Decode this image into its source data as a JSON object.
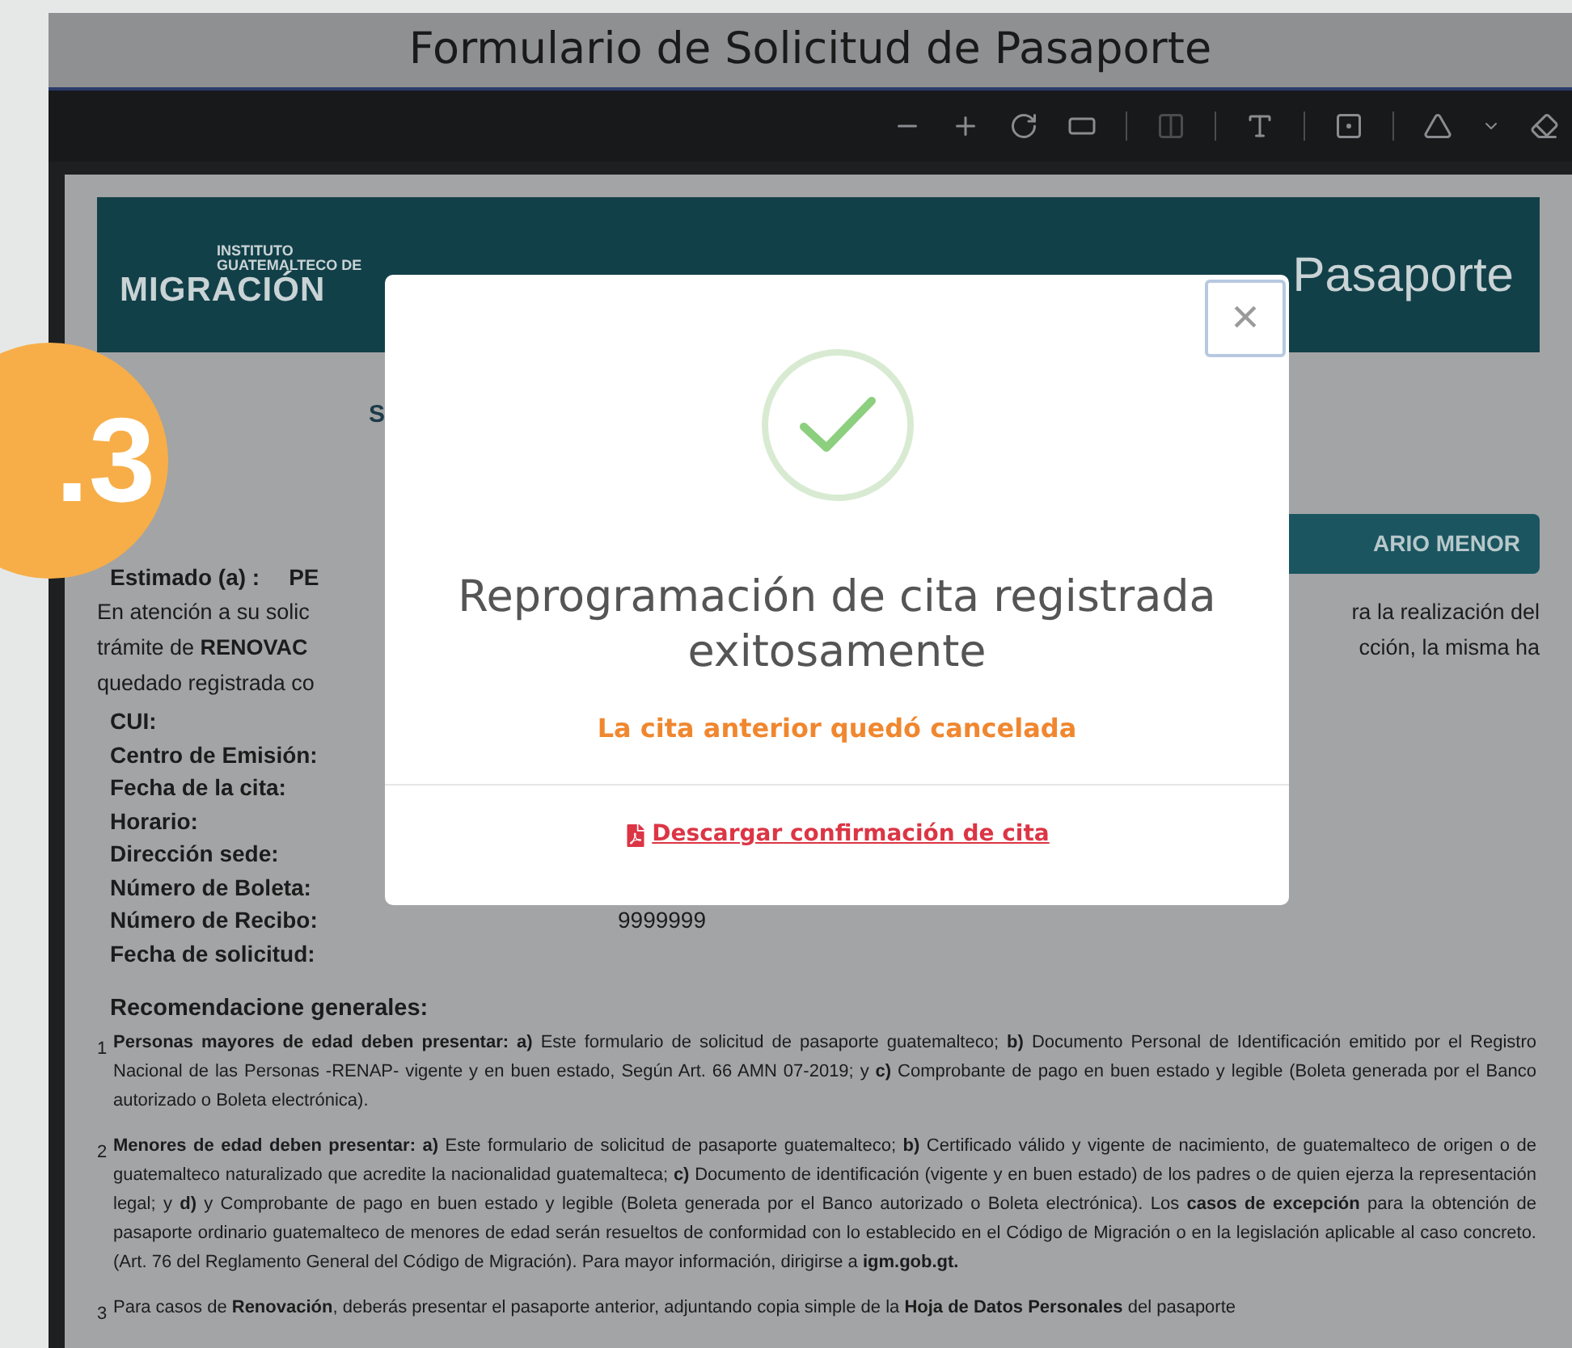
{
  "viewer": {
    "title": "Formulario de Solicitud de Pasaporte"
  },
  "badge": {
    "label": ".3"
  },
  "document": {
    "banner": {
      "org_line1": "INSTITUTO",
      "org_line2": "GUATEMALTECO DE",
      "org_name": "MIGRACIÓN",
      "title_visible": "Pasaporte"
    },
    "heading_fragment": "S",
    "button_fragment": "ARIO MENOR",
    "greeting": {
      "label": "Estimado (a) :",
      "value_fragment": "PE"
    },
    "intro_lines": [
      {
        "left": "En atención a su solic",
        "right": "ra la realización del"
      },
      {
        "left": "trámite de **RENOVAC**",
        "right": "cción, la misma ha"
      },
      {
        "left": "quedado registrada co"
      }
    ],
    "fields": [
      {
        "label": "CUI:"
      },
      {
        "label": "Centro de Emisión:"
      },
      {
        "label": "Fecha de la cita:"
      },
      {
        "label": "Horario:"
      },
      {
        "label": "Dirección sede:"
      },
      {
        "label": "Número de Boleta:"
      },
      {
        "label": "Número de Recibo:",
        "value": "9999999"
      },
      {
        "label": "Fecha de solicitud:"
      }
    ],
    "recommendations_title": "Recomendacione generales:",
    "recommendations": [
      {
        "number": "1",
        "text": "**Personas mayores de edad deben presentar: a)** Este formulario de solicitud de pasaporte guatemalteco; **b)** Documento Personal de Identificación emitido por el Registro Nacional de las Personas -RENAP- vigente y en buen estado, Según Art. 66 AMN 07-2019; y **c)** Comprobante de pago en buen estado y legible (Boleta generada por el Banco autorizado o Boleta electrónica)."
      },
      {
        "number": "2",
        "text": "**Menores de edad deben presentar: a)** Este formulario de solicitud de pasaporte guatemalteco; **b)** Certificado válido y vigente de nacimiento, de guatemalteco de origen o de guatemalteco naturalizado que acredite la nacionalidad guatemalteca;  **c)** Documento de identificación (vigente y en buen estado) de los padres o de quien ejerza la representación legal; y **d)** y Comprobante de pago en buen estado y legible (Boleta generada por el Banco autorizado o Boleta electrónica). Los **casos de excepción** para la obtención de pasaporte ordinario guatemalteco de menores de edad serán resueltos de conformidad con lo establecido en el Código de Migración o en la legislación aplicable al caso concreto. (Art. 76 del Reglamento General del Código de Migración). Para mayor información, dirigirse a **igm.gob.gt.**"
      },
      {
        "number": "3",
        "text": "Para casos de **Renovación**, deberás presentar el pasaporte anterior, adjuntando copia simple de la **Hoja de Datos Personales** del pasaporte"
      }
    ]
  },
  "modal": {
    "close": "×",
    "title": "Reprogramación de cita registrada exitosamente",
    "subtitle": "La cita anterior quedó cancelada",
    "link": "Descargar confirmación de cita"
  }
}
